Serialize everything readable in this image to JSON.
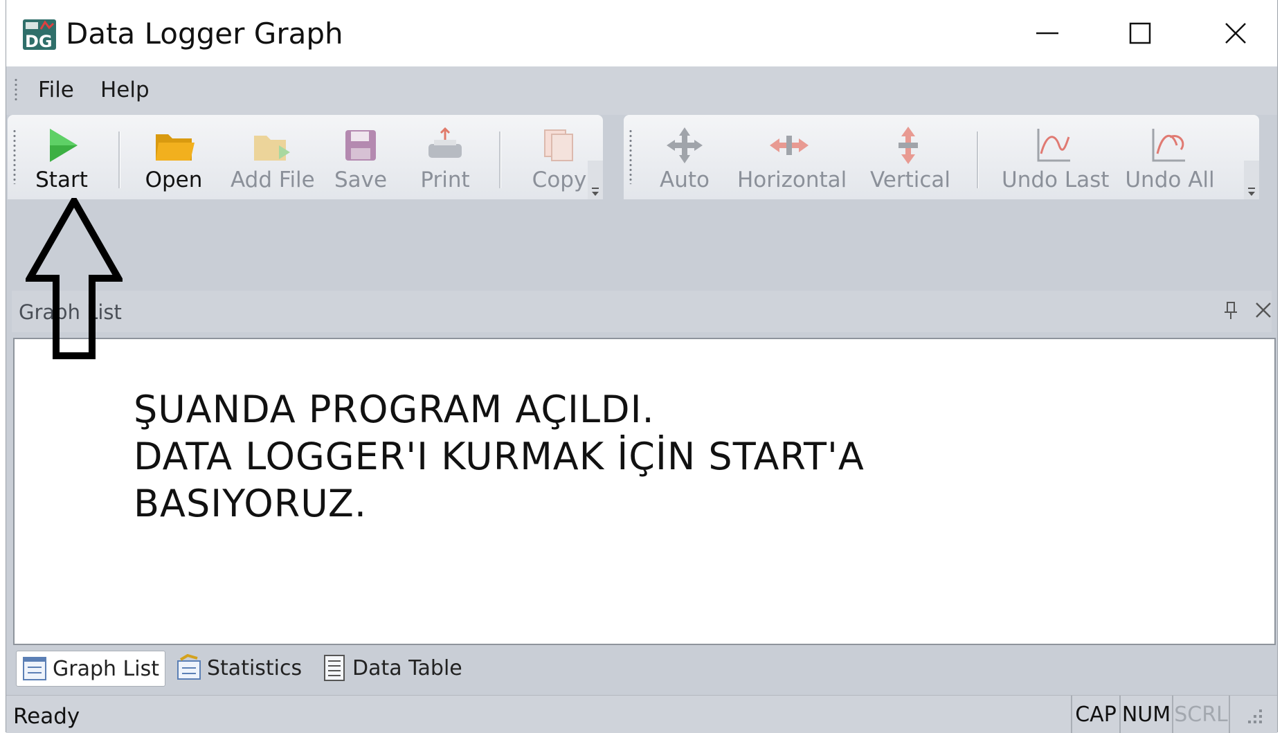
{
  "window": {
    "title": "Data Logger Graph",
    "icon": "app-dg-icon",
    "controls": [
      "minimize-icon",
      "maximize-icon",
      "close-icon"
    ]
  },
  "menu": {
    "items": [
      {
        "label": "File"
      },
      {
        "label": "Help"
      }
    ]
  },
  "toolbar_main": {
    "buttons": [
      {
        "label": "Start",
        "icon": "play-icon",
        "enabled": true
      },
      {
        "label": "Open",
        "icon": "folder-icon",
        "enabled": true
      },
      {
        "label": "Add File",
        "icon": "add-file-icon",
        "enabled": false
      },
      {
        "label": "Save",
        "icon": "save-icon",
        "enabled": false
      },
      {
        "label": "Print",
        "icon": "print-icon",
        "enabled": false
      },
      {
        "label": "Copy",
        "icon": "copy-icon",
        "enabled": false
      }
    ]
  },
  "toolbar_zoom": {
    "buttons": [
      {
        "label": "Auto",
        "icon": "auto-zoom-icon",
        "enabled": false
      },
      {
        "label": "Horizontal",
        "icon": "horizontal-zoom-icon",
        "enabled": false
      },
      {
        "label": "Vertical",
        "icon": "vertical-zoom-icon",
        "enabled": false
      },
      {
        "label": "Undo Last",
        "icon": "undo-last-icon",
        "enabled": false
      },
      {
        "label": "Undo All",
        "icon": "undo-all-icon",
        "enabled": false
      }
    ]
  },
  "panel": {
    "title": "Graph List",
    "pin_icon": "pin-icon",
    "close_icon": "close-icon"
  },
  "annotation": {
    "lines": [
      "ŞUANDA PROGRAM AÇILDI.",
      "DATA LOGGER'I KURMAK İÇİN START'A",
      "BASIYORUZ."
    ],
    "arrow": "up-arrow-icon"
  },
  "tabs": [
    {
      "label": "Graph List",
      "icon": "graph-list-icon",
      "active": true
    },
    {
      "label": "Statistics",
      "icon": "statistics-icon",
      "active": false
    },
    {
      "label": "Data Table",
      "icon": "data-table-icon",
      "active": false
    }
  ],
  "status": {
    "text": "Ready",
    "indicators": [
      {
        "label": "CAP",
        "active": true
      },
      {
        "label": "NUM",
        "active": true
      },
      {
        "label": "SCRL",
        "active": false
      }
    ]
  },
  "colors": {
    "play_green": "#3cb043",
    "folder_yellow": "#f2b01e",
    "disabled_text": "#8b9099",
    "chrome_gray": "#c9ced6"
  }
}
